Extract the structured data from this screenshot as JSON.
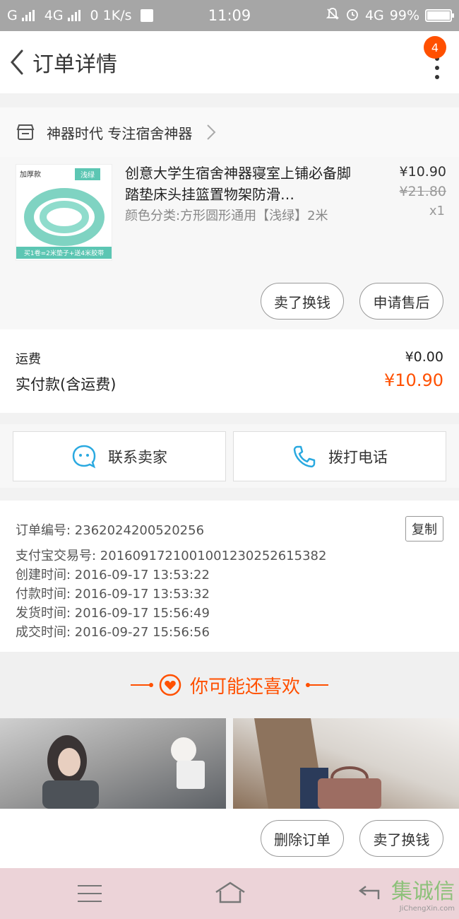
{
  "status_bar": {
    "carrier": "G",
    "network": "4G",
    "speed": "0",
    "speed_unit": "1K/s",
    "time": "11:09",
    "network2": "4G",
    "battery": "99%"
  },
  "nav": {
    "title": "订单详情",
    "badge": "4"
  },
  "shop": {
    "name": "神器时代 专注宿舍神器"
  },
  "item": {
    "thumb_tag_left": "加厚款",
    "thumb_tag_right": "浅绿",
    "thumb_bottom": "买1卷=2米垫子+送4米胶带",
    "name": "创意大学生宿舍神器寝室上铺必备脚踏垫床头挂篮置物架防滑…",
    "sku": "颜色分类:方形圆形通用【浅绿】2米",
    "price": "¥10.90",
    "original_price": "¥21.80",
    "quantity": "x1",
    "buttons": [
      "卖了换钱",
      "申请售后"
    ]
  },
  "fees": {
    "shipping_label": "运费",
    "shipping_value": "¥0.00",
    "total_label": "实付款(含运费)",
    "total_value": "¥10.90"
  },
  "contact": {
    "seller": "联系卖家",
    "phone": "拨打电话"
  },
  "order_info": {
    "copy": "复制",
    "lines": [
      "订单编号: 2362024200520256",
      "支付宝交易号: 2016091721001001230252615382",
      "创建时间: 2016-09-17 13:53:22",
      "付款时间: 2016-09-17 13:53:32",
      "发货时间: 2016-09-17 15:56:49",
      "成交时间: 2016-09-27 15:56:56"
    ]
  },
  "recommend": {
    "title": "你可能还喜欢"
  },
  "bottom_actions": [
    "删除订单",
    "卖了换钱"
  ],
  "watermark": {
    "main": "集诚信",
    "sub": "JiChengXin.com"
  },
  "colors": {
    "accent": "#ff5000",
    "link_icon": "#2aa9e0",
    "thumb_green": "#5cc6b3"
  }
}
